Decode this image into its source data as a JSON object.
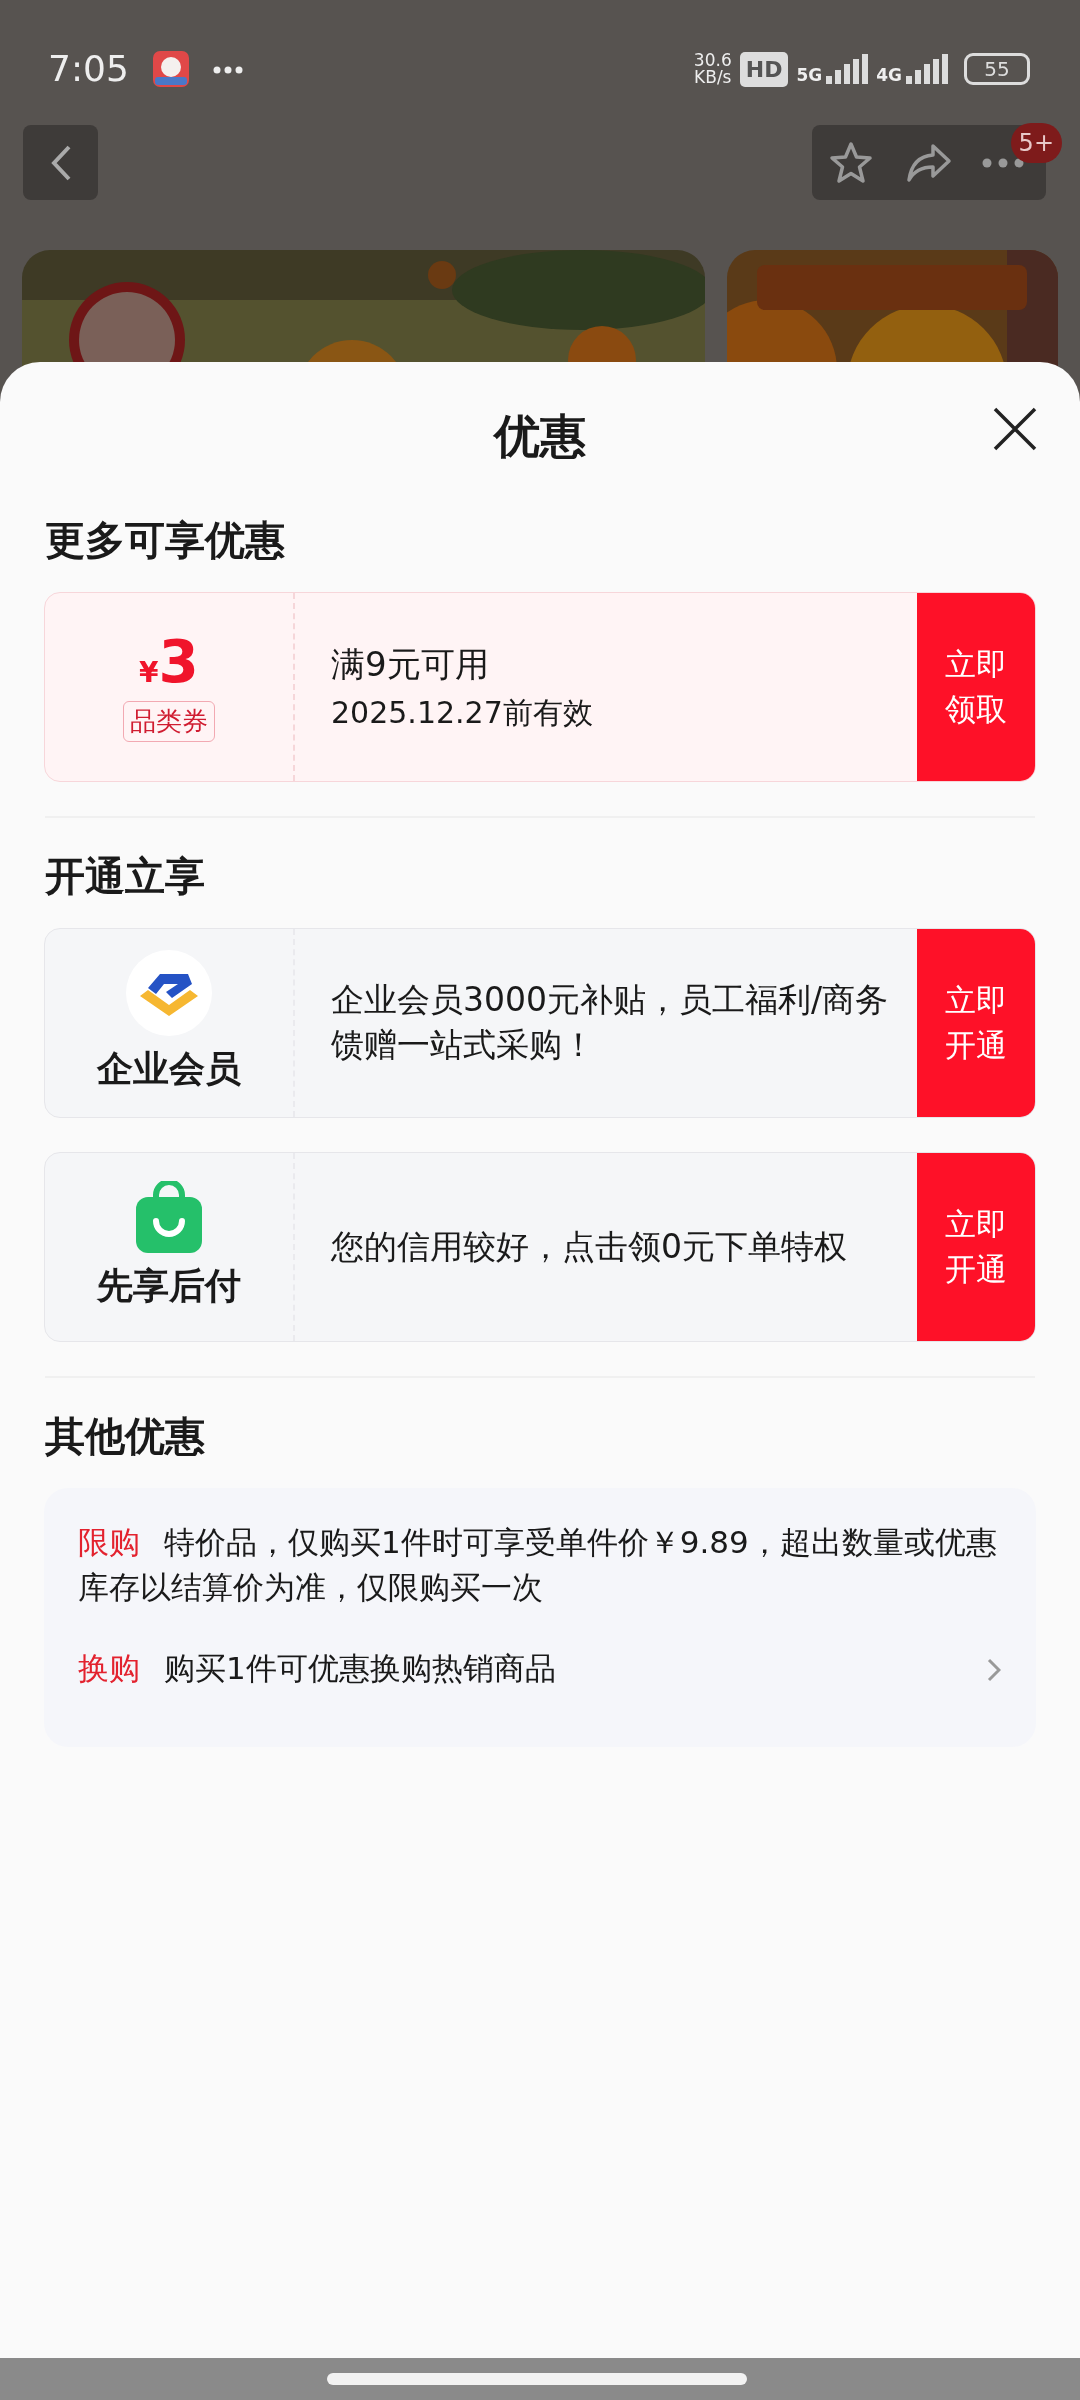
{
  "status_bar": {
    "time": "7:05",
    "speed_value": "30.6",
    "speed_unit": "KB/s",
    "hd": "HD",
    "networks": [
      "5G",
      "4G"
    ],
    "battery": "55"
  },
  "top_bar": {
    "badge": "5+"
  },
  "sheet": {
    "title": "优惠",
    "sections": [
      {
        "title": "更多可享优惠",
        "kind": "coupon",
        "items": [
          {
            "currency": "¥",
            "amount": "3",
            "tag": "品类券",
            "condition": "满9元可用",
            "validity": "2025.12.27前有效",
            "button": "立即领取"
          }
        ]
      },
      {
        "title": "开通立享",
        "kind": "service",
        "items": [
          {
            "kind": "member",
            "name": "企业会员",
            "description": "企业会员3000元补贴，员工福利/商务馈赠一站式采购！",
            "button": "立即开通"
          },
          {
            "kind": "credit",
            "name": "先享后付",
            "description": "您的信用较好，点击领0元下单特权",
            "button": "立即开通"
          }
        ]
      },
      {
        "title": "其他优惠",
        "kind": "other",
        "items": [
          {
            "tag": "限购",
            "text": "特价品，仅购买1件时可享受单件价￥9.89，超出数量或优惠库存以结算价为准，仅限购买一次",
            "arrow": false
          },
          {
            "tag": "换购",
            "text": "购买1件可优惠换购热销商品",
            "arrow": true
          }
        ]
      }
    ]
  }
}
